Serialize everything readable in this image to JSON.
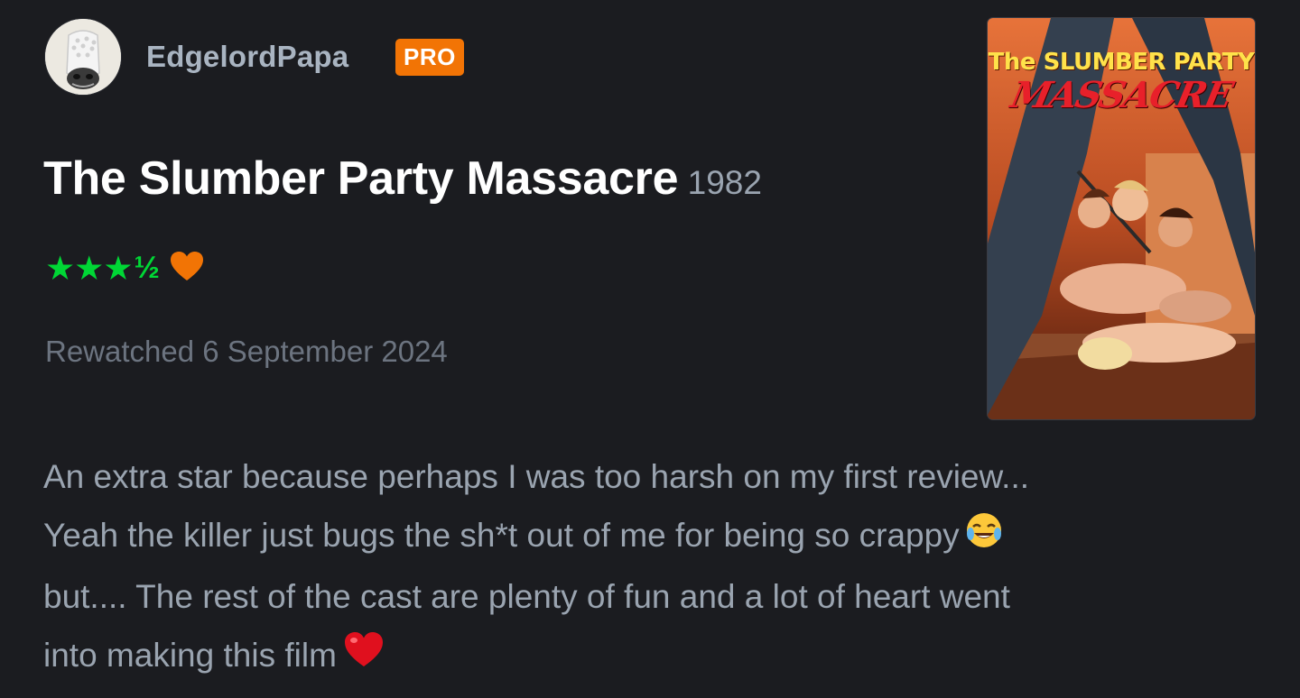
{
  "user": {
    "name": "EdgelordPapa",
    "badge": "PRO",
    "avatar_icon": "crocs-avatar-icon"
  },
  "film": {
    "title": "The Slumber Party Massacre",
    "year": "1982"
  },
  "rating": {
    "stars": "★★★",
    "half": "½",
    "stars_value": 3.5,
    "liked": true,
    "star_color": "#00d735",
    "like_color": "#f27405"
  },
  "watched": "Rewatched 6 September 2024",
  "poster": {
    "title_top": "The SLUMBER PARTY",
    "title_bottom": "MASSACRE"
  },
  "review": {
    "lines": [
      "An extra star because perhaps I was too harsh on my first review...",
      "Yeah the killer just bugs the sh*t out of me for being so crappy",
      "but.... The rest of the cast are plenty of fun and a lot of heart went",
      "into making this film"
    ],
    "emojis": [
      "laughing-crying-emoji",
      "red-heart-emoji"
    ]
  },
  "colors": {
    "background": "#1b1c20",
    "badge": "#f27405",
    "text_secondary": "#9aa4b0"
  }
}
